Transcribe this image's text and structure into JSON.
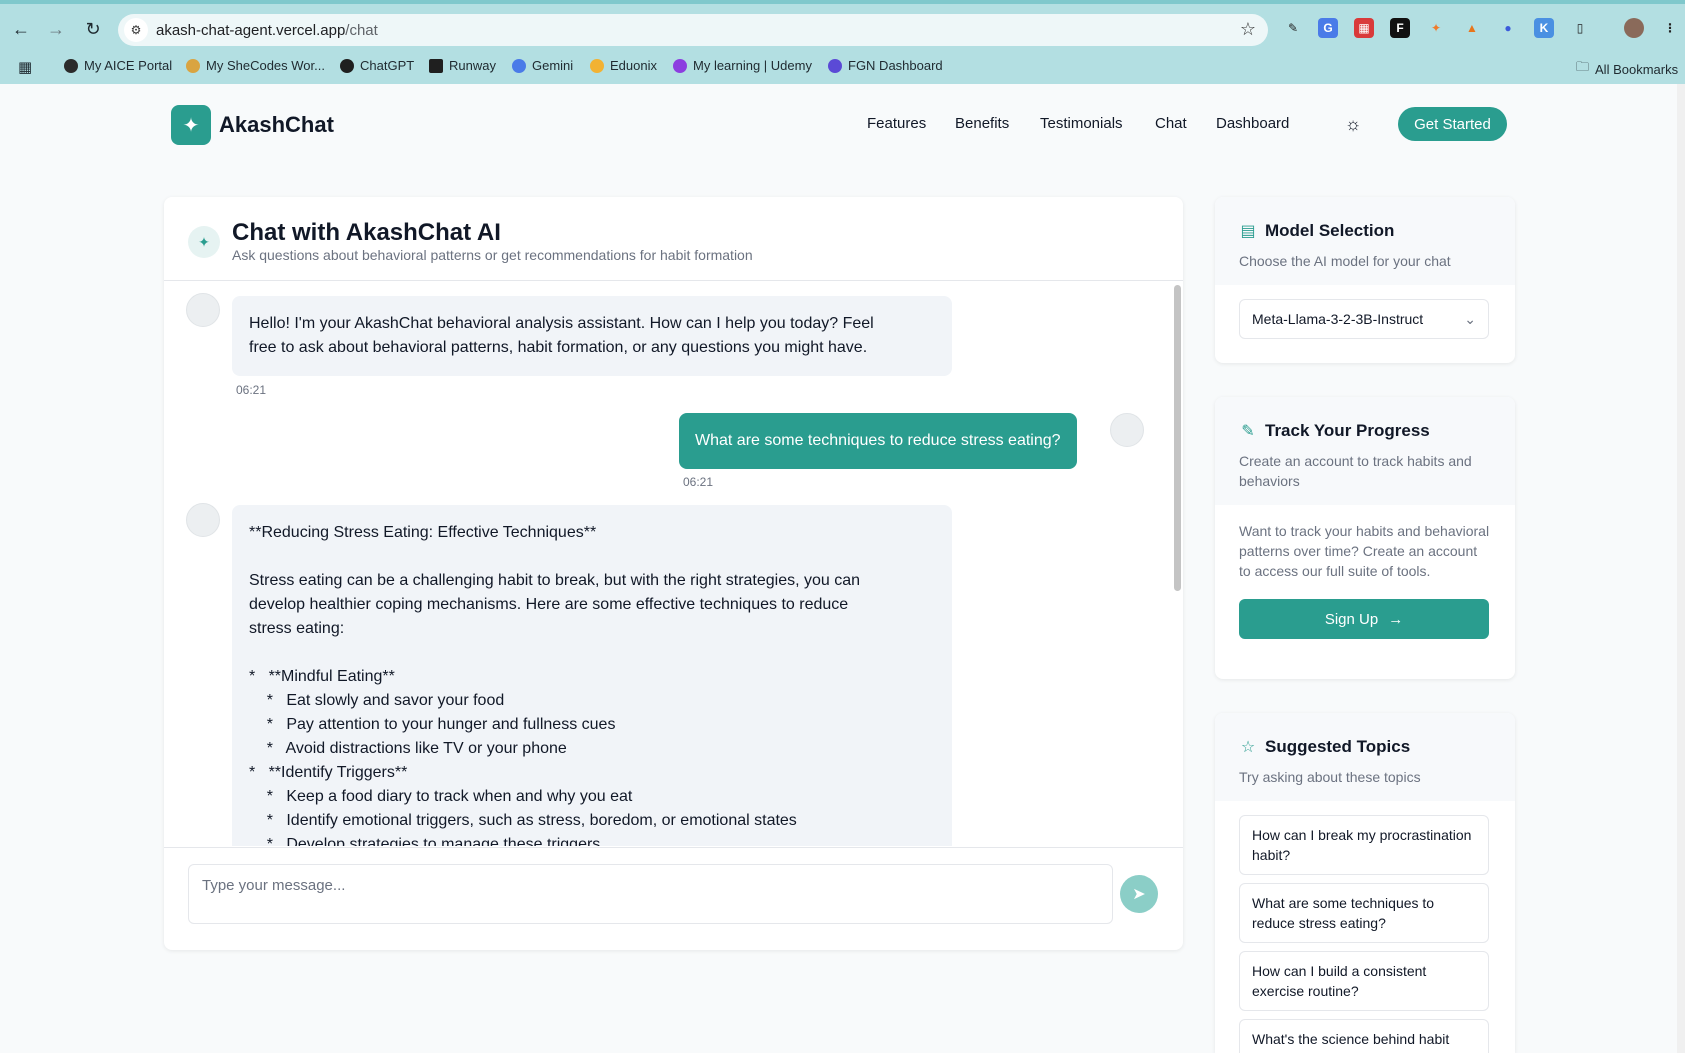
{
  "browser": {
    "url_domain": "akash-chat-agent.vercel.app",
    "url_path": "/chat",
    "bookmarks": [
      {
        "label": "My AICE Portal",
        "color": "#2b2b2b"
      },
      {
        "label": "My SheCodes Wor...",
        "color": "#d9a441"
      },
      {
        "label": "ChatGPT",
        "color": "#1f1f1f"
      },
      {
        "label": "Runway",
        "color": "#1f1f1f"
      },
      {
        "label": "Gemini",
        "color": "#4a7be8"
      },
      {
        "label": "Eduonix",
        "color": "#f2b233"
      },
      {
        "label": "My learning | Udemy",
        "color": "#8c3ee0"
      },
      {
        "label": "FGN Dashboard",
        "color": "#5b4ad6"
      }
    ],
    "all_bookmarks": "All Bookmarks"
  },
  "header": {
    "logo_text": "AkashChat",
    "nav": [
      "Features",
      "Benefits",
      "Testimonials",
      "Chat",
      "Dashboard"
    ],
    "cta": "Get Started"
  },
  "chat": {
    "title": "Chat with AkashChat AI",
    "subtitle": "Ask questions about behavioral patterns or get recommendations for habit formation",
    "messages": [
      {
        "role": "assistant",
        "lines": [
          "Hello! I'm your AkashChat behavioral analysis assistant. How can I help you today? Feel",
          "free to ask about behavioral patterns, habit formation, or any questions you might have."
        ],
        "time": "06:21"
      },
      {
        "role": "user",
        "text": "What are some techniques to reduce stress eating?",
        "time": "06:21"
      },
      {
        "role": "assistant",
        "lines": [
          "**Reducing Stress Eating: Effective Techniques**",
          "",
          "Stress eating can be a challenging habit to break, but with the right strategies, you can",
          "develop healthier coping mechanisms. Here are some effective techniques to reduce",
          "stress eating:",
          "",
          "*   **Mindful Eating**",
          "    *   Eat slowly and savor your food",
          "    *   Pay attention to your hunger and fullness cues",
          "    *   Avoid distractions like TV or your phone",
          "*   **Identify Triggers**",
          "    *   Keep a food diary to track when and why you eat",
          "    *   Identify emotional triggers, such as stress, boredom, or emotional states",
          "    *   Develop strategies to manage these triggers"
        ]
      }
    ],
    "input_placeholder": "Type your message..."
  },
  "model_card": {
    "title": "Model Selection",
    "subtitle": "Choose the AI model for your chat",
    "selected_model": "Meta-Llama-3-2-3B-Instruct"
  },
  "progress_card": {
    "title": "Track Your Progress",
    "subtitle": "Create an account to track habits and behaviors",
    "body": "Want to track your habits and behavioral patterns over time? Create an account to access our full suite of tools.",
    "button": "Sign Up"
  },
  "topics_card": {
    "title": "Suggested Topics",
    "subtitle": "Try asking about these topics",
    "topics": [
      "How can I break my procrastination habit?",
      "What are some techniques to reduce stress eating?",
      "How can I build a consistent exercise routine?",
      "What's the science behind habit"
    ]
  },
  "colors": {
    "accent": "#2a9d8f",
    "chrome": "#b3dfe2"
  }
}
